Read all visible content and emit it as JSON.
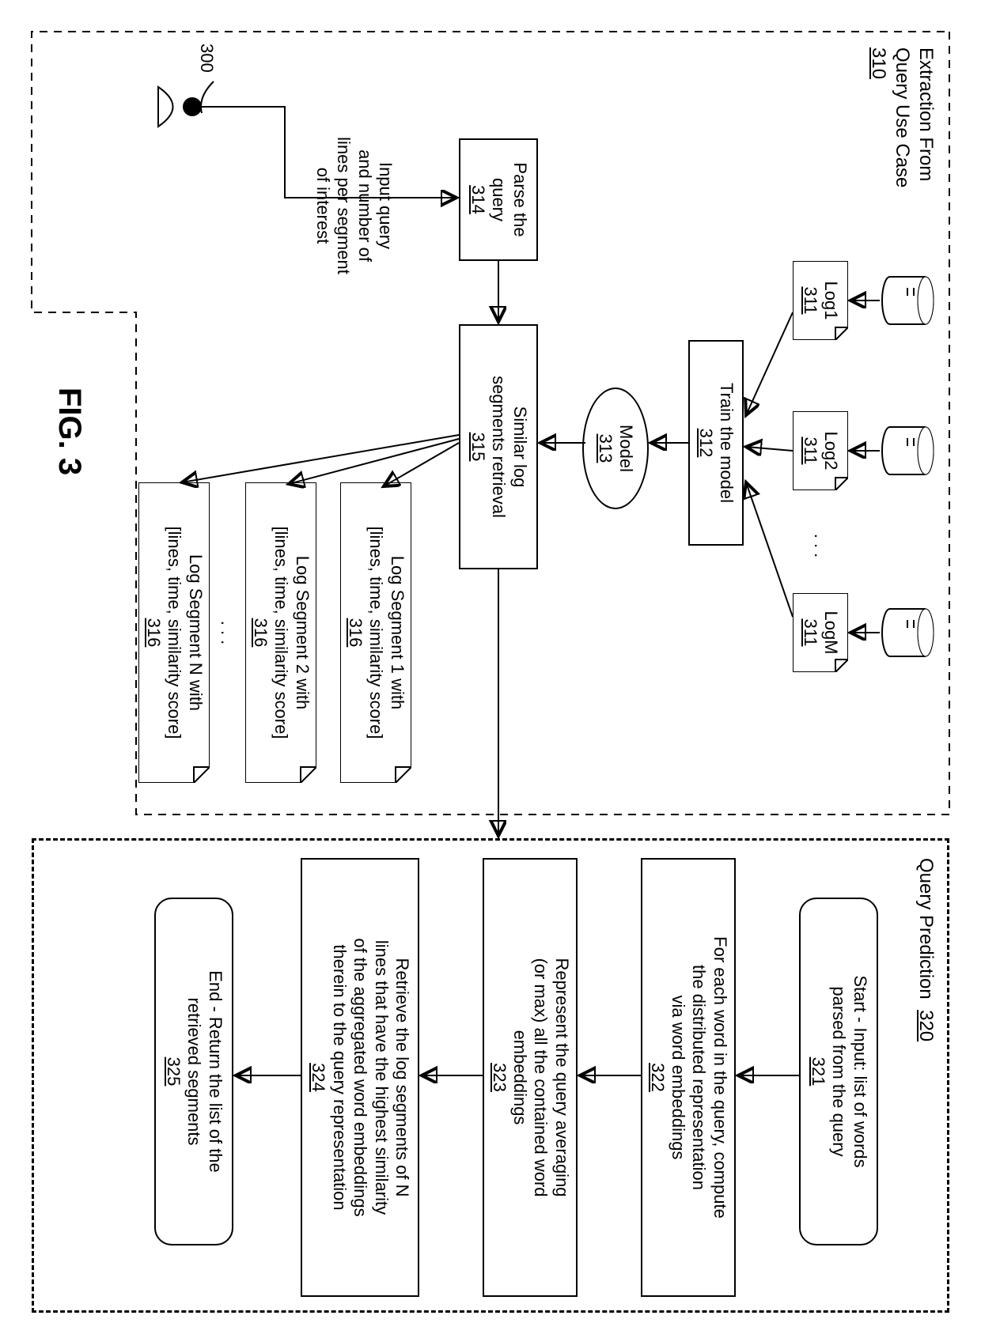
{
  "left_panel": {
    "title": "Extraction From\nQuery Use Case",
    "ref": "310",
    "logs": [
      {
        "name": "Log1",
        "ref": "311"
      },
      {
        "name": "Log2",
        "ref": "311"
      },
      {
        "name": "LogM",
        "ref": "311"
      }
    ],
    "log_ellipsis": ". . .",
    "train": {
      "text": "Train the model",
      "ref": "312"
    },
    "model": {
      "text": "Model",
      "ref": "313"
    },
    "parse": {
      "text": "Parse the\nquery",
      "ref": "314"
    },
    "retrieval": {
      "text": "Similar log\nsegments retrieval",
      "ref": "315"
    },
    "segments": [
      {
        "text": "Log Segment 1 with\n[lines, time, similarity score]",
        "ref": "316"
      },
      {
        "text": "Log Segment 2 with\n[lines, time, similarity score]",
        "ref": "316"
      },
      {
        "text": "Log Segment N with\n[lines, time, similarity score]",
        "ref": "316"
      }
    ],
    "segment_ellipsis": ". . .",
    "user_input": "Input query\nand number of\nlines per segment\nof interest",
    "user_ref": "300"
  },
  "right_panel": {
    "title": "Query Prediction",
    "ref": "320",
    "steps": [
      {
        "text": "Start - Input: list of words\nparsed from the query",
        "ref": "321",
        "rounded": true
      },
      {
        "text": "For each word in the query, compute\nthe distributed representation\nvia word embeddings",
        "ref": "322",
        "rounded": false
      },
      {
        "text": "Represent the query averaging\n(or max) all the contained word\nembeddings",
        "ref": "323",
        "rounded": false
      },
      {
        "text": "Retrieve the log segments of N\nlines that have the highest similarity\nof the aggregated word embeddings\ntherein to the query representation",
        "ref": "324",
        "rounded": false
      },
      {
        "text": "End - Return the list of the\nretrieved segments",
        "ref": "325",
        "rounded": true
      }
    ]
  },
  "figure": "FIG. 3"
}
